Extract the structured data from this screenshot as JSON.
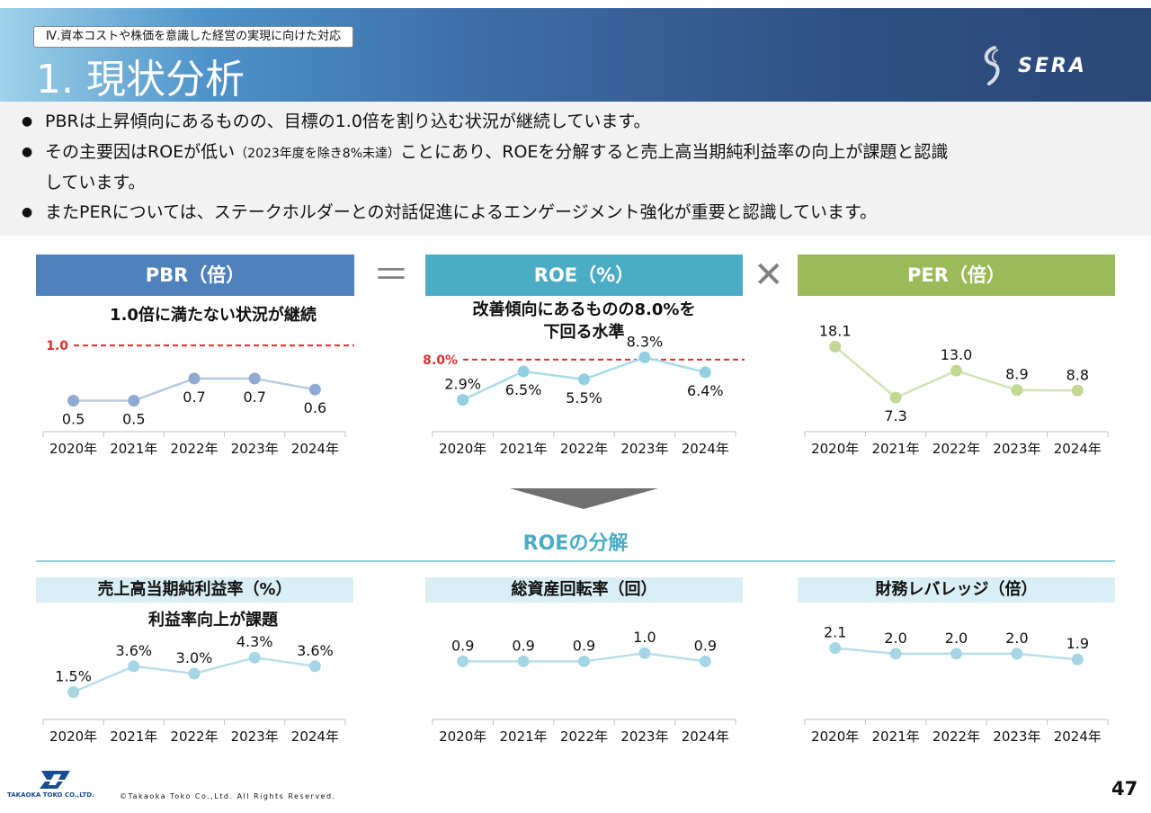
{
  "header": {
    "section_tag": "Ⅳ.資本コストや株価を意識した経営の実現に向けた対応",
    "title": "1. 現状分析",
    "brand": "SERA"
  },
  "bullets": [
    {
      "text": "PBRは上昇傾向にあるものの、目標の1.0倍を割り込む状況が継続しています。"
    },
    {
      "pre": "その主要因はROEが低い",
      "small": "（2023年度を除き8%未達）",
      "post": "ことにあり、ROEを分解すると売上高当期純利益率の向上が課題と認識",
      "line2": "しています。"
    },
    {
      "text": "またPERについては、ステークホルダーとの対話促進によるエンゲージメント強化が重要と認識しています。"
    }
  ],
  "operators": {
    "equals": "＝",
    "times": "✕"
  },
  "pbr": {
    "header": "PBR（倍）",
    "caption": "1.0倍に満たない状況が継続",
    "target_label": "1.0"
  },
  "roe": {
    "header": "ROE（%）",
    "caption_line1": "改善傾向にあるものの8.0%を",
    "caption_line2": "下回る水準",
    "target_label": "8.0%"
  },
  "per": {
    "header": "PER（倍）"
  },
  "decomposition_title": "ROEの分解",
  "margin": {
    "header": "売上高当期純利益率（%）",
    "caption": "利益率向上が課題"
  },
  "turnover": {
    "header": "総資産回転率（回）"
  },
  "leverage": {
    "header": "財務レバレッジ（倍）"
  },
  "colors": {
    "pbr": "#4f81bd",
    "pbr_line": "#b8c9e4",
    "pbr_dot": "#8eaad3",
    "roe": "#4bacc6",
    "roe_line": "#a9dcea",
    "roe_dot": "#92cfe2",
    "per": "#9bbb59",
    "per_line": "#d4e3b5",
    "per_dot": "#c2d894",
    "light_line": "#b7dfea",
    "light_dot": "#a6d6e6",
    "target": "#e03030"
  },
  "chart_data": [
    {
      "type": "line",
      "id": "pbr",
      "categories": [
        "2020年",
        "2021年",
        "2022年",
        "2023年",
        "2024年"
      ],
      "values": [
        0.5,
        0.5,
        0.7,
        0.7,
        0.6
      ],
      "value_labels": [
        "0.5",
        "0.5",
        "0.7",
        "0.7",
        "0.6"
      ],
      "target": 1.0,
      "ylim": [
        0.3,
        1.05
      ],
      "label_pos": [
        "below",
        "below",
        "below",
        "below",
        "below"
      ]
    },
    {
      "type": "line",
      "id": "roe",
      "categories": [
        "2020年",
        "2021年",
        "2022年",
        "2023年",
        "2024年"
      ],
      "values": [
        2.9,
        6.5,
        5.5,
        8.3,
        6.4
      ],
      "value_labels": [
        "2.9%",
        "6.5%",
        "5.5%",
        "8.3%",
        "6.4%"
      ],
      "target": 8.0,
      "ylim": [
        0,
        10.5
      ],
      "label_pos": [
        "above",
        "below",
        "below",
        "above",
        "below"
      ]
    },
    {
      "type": "line",
      "id": "per",
      "categories": [
        "2020年",
        "2021年",
        "2022年",
        "2023年",
        "2024年"
      ],
      "values": [
        18.1,
        7.3,
        13.0,
        8.9,
        8.8
      ],
      "value_labels": [
        "18.1",
        "7.3",
        "13.0",
        "8.9",
        "8.8"
      ],
      "ylim": [
        2,
        19.5
      ],
      "label_pos": [
        "above",
        "below",
        "above",
        "above",
        "above"
      ]
    },
    {
      "type": "line",
      "id": "margin",
      "categories": [
        "2020年",
        "2021年",
        "2022年",
        "2023年",
        "2024年"
      ],
      "values": [
        1.5,
        3.6,
        3.0,
        4.3,
        3.6
      ],
      "value_labels": [
        "1.5%",
        "3.6%",
        "3.0%",
        "4.3%",
        "3.6%"
      ],
      "ylim": [
        0,
        6.0
      ],
      "label_pos": [
        "above",
        "above",
        "above",
        "above",
        "above"
      ]
    },
    {
      "type": "line",
      "id": "turnover",
      "categories": [
        "2020年",
        "2021年",
        "2022年",
        "2023年",
        "2024年"
      ],
      "values": [
        0.9,
        0.9,
        0.9,
        1.0,
        0.9
      ],
      "value_labels": [
        "0.9",
        "0.9",
        "0.9",
        "1.0",
        "0.9"
      ],
      "ylim": [
        0.3,
        1.2
      ],
      "label_pos": [
        "above",
        "above",
        "above",
        "above",
        "above"
      ]
    },
    {
      "type": "line",
      "id": "leverage",
      "categories": [
        "2020年",
        "2021年",
        "2022年",
        "2023年",
        "2024年"
      ],
      "values": [
        2.1,
        2.0,
        2.0,
        2.0,
        1.9
      ],
      "value_labels": [
        "2.1",
        "2.0",
        "2.0",
        "2.0",
        "1.9"
      ],
      "ylim": [
        1.0,
        2.3
      ],
      "label_pos": [
        "above",
        "above",
        "above",
        "above",
        "above"
      ]
    }
  ],
  "footer": {
    "company": "TAKAOKA TOKO CO.,LTD.",
    "copyright": "©Takaoka Toko Co.,Ltd. All Rights Reserved.",
    "page_number": "47"
  }
}
